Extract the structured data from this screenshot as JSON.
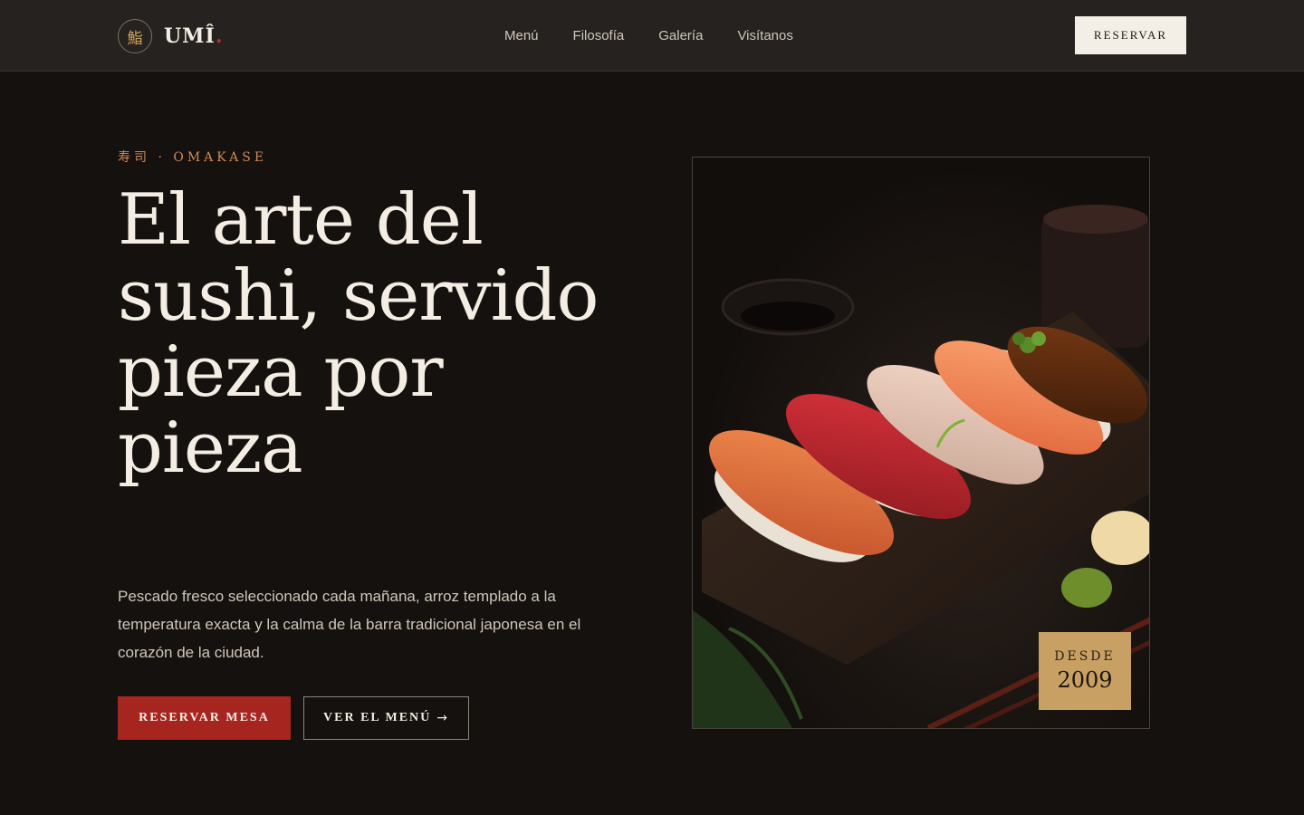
{
  "header": {
    "logo_mark": "鮨",
    "brand": "UMÎ",
    "brand_dot": ".",
    "nav": [
      {
        "label": "Menú"
      },
      {
        "label": "Filosofía"
      },
      {
        "label": "Galería"
      },
      {
        "label": "Visítanos"
      }
    ],
    "reserve_label": "RESERVAR"
  },
  "hero": {
    "kicker": "寿司 · OMAKASE",
    "headline": "El arte del sushi, servido pieza por pieza",
    "lead": "Pescado fresco seleccionado cada mañana, arroz templado a la temperatura exacta y la calma de la barra tradicional japonesa en el corazón de la ciudad.",
    "primary_cta": "RESERVAR MESA",
    "secondary_cta": "VER EL MENÚ",
    "secondary_cta_arrow": "→"
  },
  "photo": {
    "badge_label": "DESDE",
    "badge_year": "2009"
  },
  "colors": {
    "background": "#15110f",
    "header": "#262220",
    "accent_red": "#a6261f",
    "accent_gold": "#c8a063",
    "kicker": "#d08a56"
  }
}
